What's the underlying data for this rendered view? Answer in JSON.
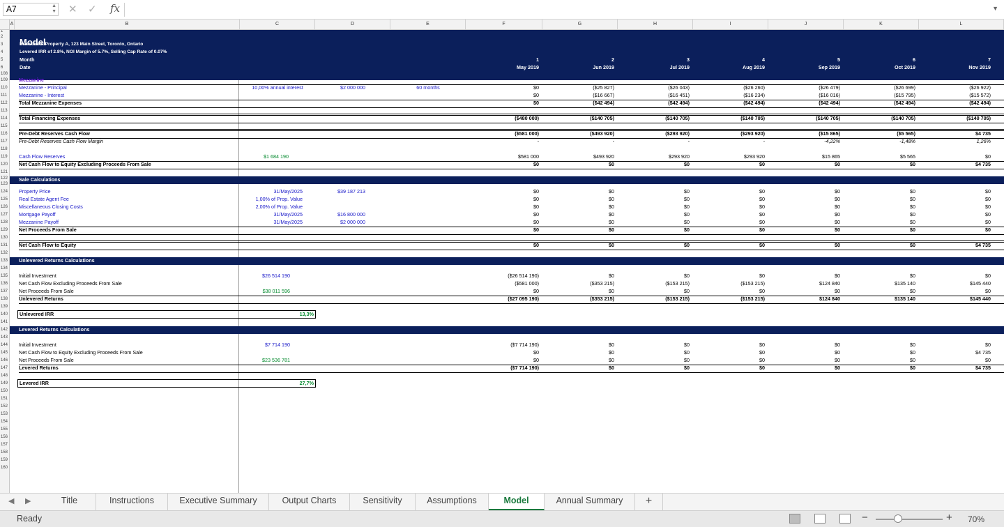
{
  "formula_bar": {
    "cell_ref": "A7",
    "fx": "fx",
    "formula": ""
  },
  "columns": [
    "A",
    "B",
    "C",
    "D",
    "E",
    "F",
    "G",
    "H",
    "I",
    "J",
    "K",
    "L"
  ],
  "rows": [
    "1",
    "2",
    "3",
    "4",
    "5",
    "6",
    "108",
    "109",
    "110",
    "111",
    "112",
    "113",
    "114",
    "115",
    "116",
    "117",
    "118",
    "119",
    "120",
    "121",
    "122",
    "123",
    "124",
    "125",
    "126",
    "127",
    "128",
    "129",
    "130",
    "131",
    "132",
    "133",
    "134",
    "135",
    "136",
    "137",
    "138",
    "139",
    "140",
    "141",
    "142",
    "143",
    "144",
    "145",
    "146",
    "147",
    "148",
    "149",
    "150",
    "151",
    "152",
    "153",
    "154",
    "155",
    "156",
    "157",
    "158",
    "159",
    "160"
  ],
  "header": {
    "title": "Model",
    "subtitle1": "Investment Property A, 123 Main Street, Toronto, Ontario",
    "subtitle2": "Levered IRR of 2.8%, NOI Margin of 5.7%, Selling Cap Rate of 0.07%",
    "month_label": "Month",
    "date_label": "Date",
    "months": [
      "1",
      "2",
      "3",
      "4",
      "5",
      "6",
      "7"
    ],
    "dates": [
      "May 2019",
      "Jun 2019",
      "Jul 2019",
      "Aug 2019",
      "Sep 2019",
      "Oct 2019",
      "Nov 2019"
    ]
  },
  "mezzanine": {
    "title": "Mezzanine",
    "principal": {
      "label": "Mezzanine - Principal",
      "c": "10,00% annual interest",
      "d": "$2 000 000",
      "e": "60 months",
      "vals": [
        "$0",
        "($25 827)",
        "($26 043)",
        "($26 260)",
        "($26 479)",
        "($26 699)",
        "($26 922)"
      ]
    },
    "interest": {
      "label": "Mezzanine - Interest",
      "vals": [
        "$0",
        "($16 667)",
        "($16 451)",
        "($16 234)",
        "($16 016)",
        "($15 795)",
        "($15 572)"
      ]
    },
    "total": {
      "label": "Total Mezzanine Expenses",
      "vals": [
        "$0",
        "($42 494)",
        "($42 494)",
        "($42 494)",
        "($42 494)",
        "($42 494)",
        "($42 494)"
      ]
    }
  },
  "financing": {
    "label": "Total Financing Expenses",
    "vals": [
      "($480 000)",
      "($140 705)",
      "($140 705)",
      "($140 705)",
      "($140 705)",
      "($140 705)",
      "($140 705)"
    ]
  },
  "predebt": {
    "label": "Pre-Debt Reserves Cash Flow",
    "vals": [
      "($581 000)",
      "($493 920)",
      "($293 920)",
      "($293 920)",
      "($15 865)",
      "($5 565)",
      "$4 735"
    ],
    "margin_label": "Pre-Debt Reserves Cash Flow Margin",
    "margin_vals": [
      "-",
      "-",
      "-",
      "-",
      "-4,22%",
      "-1,48%",
      "1,26%"
    ]
  },
  "reserves": {
    "label": "Cash Flow Reserves",
    "c": "$1 684 190",
    "vals": [
      "$581 000",
      "$493 920",
      "$293 920",
      "$293 920",
      "$15 865",
      "$5 565",
      "$0"
    ]
  },
  "ncf_excl": {
    "label": "Net Cash Flow to Equity Excluding Proceeds From Sale",
    "vals": [
      "$0",
      "$0",
      "$0",
      "$0",
      "$0",
      "$0",
      "$4 735"
    ]
  },
  "sale": {
    "title": "Sale Calculations",
    "items": [
      {
        "label": "Property Price",
        "c": "31/May/2025",
        "d": "$39 187 213"
      },
      {
        "label": "Real Estate Agent Fee",
        "c": "1,00% of Prop. Value",
        "d": ""
      },
      {
        "label": "Miscellaneous Closing Costs",
        "c": "2,00% of Prop. Value",
        "d": ""
      },
      {
        "label": "Mortgage Payoff",
        "c": "31/May/2025",
        "d": "$16 800 000"
      },
      {
        "label": "Mezzanine Payoff",
        "c": "31/May/2025",
        "d": "$2 000 000"
      }
    ],
    "zero": "$0",
    "net_label": "Net Proceeds From Sale"
  },
  "ncf_equity": {
    "label": "Net Cash Flow to Equity",
    "vals": [
      "$0",
      "$0",
      "$0",
      "$0",
      "$0",
      "$0",
      "$4 735"
    ]
  },
  "unlevered": {
    "title": "Unlevered Returns Calculations",
    "initial": {
      "label": "Initial Investment",
      "c": "$26 514 190",
      "vals": [
        "($26 514 190)",
        "$0",
        "$0",
        "$0",
        "$0",
        "$0",
        "$0"
      ]
    },
    "ncf": {
      "label": "Net Cash Flow Excluding Proceeds From Sale",
      "vals": [
        "($581 000)",
        "($353 215)",
        "($153 215)",
        "($153 215)",
        "$124 840",
        "$135 140",
        "$145 440"
      ]
    },
    "proceeds": {
      "label": "Net Proceeds From Sale",
      "c": "$38 011 596",
      "vals": [
        "$0",
        "$0",
        "$0",
        "$0",
        "$0",
        "$0",
        "$0"
      ]
    },
    "returns": {
      "label": "Unlevered Returns",
      "vals": [
        "($27 095 190)",
        "($353 215)",
        "($153 215)",
        "($153 215)",
        "$124 840",
        "$135 140",
        "$145 440"
      ]
    },
    "irr_label": "Unlevered IRR",
    "irr": "13,3%"
  },
  "levered": {
    "title": "Levered Returns Calculations",
    "initial": {
      "label": "Initial Investment",
      "c": "$7 714 190",
      "vals": [
        "($7 714 190)",
        "$0",
        "$0",
        "$0",
        "$0",
        "$0",
        "$0"
      ]
    },
    "ncf": {
      "label": "Net Cash Flow to Equity Excluding Proceeds From Sale",
      "vals": [
        "$0",
        "$0",
        "$0",
        "$0",
        "$0",
        "$0",
        "$4 735"
      ]
    },
    "proceeds": {
      "label": "Net Proceeds From Sale",
      "c": "$23 536 781",
      "vals": [
        "$0",
        "$0",
        "$0",
        "$0",
        "$0",
        "$0",
        "$0"
      ]
    },
    "returns": {
      "label": "Levered Returns",
      "vals": [
        "($7 714 190)",
        "$0",
        "$0",
        "$0",
        "$0",
        "$0",
        "$4 735"
      ]
    },
    "irr_label": "Levered IRR",
    "irr": "27,7%"
  },
  "tabs": [
    "Title",
    "Instructions",
    "Executive Summary",
    "Output Charts",
    "Sensitivity",
    "Assumptions",
    "Model",
    "Annual Summary"
  ],
  "active_tab": "Model",
  "add_tab": "+",
  "status": {
    "ready": "Ready",
    "zoom": "70%",
    "minus": "−",
    "plus": "+"
  }
}
